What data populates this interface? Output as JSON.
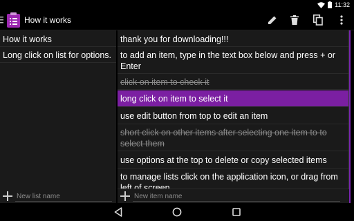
{
  "status_bar": {
    "time": "11:32"
  },
  "action_bar": {
    "title": "How it works",
    "icons": [
      "pencil-icon",
      "trash-icon",
      "copy-icon",
      "overflow-icon"
    ]
  },
  "lists": [
    {
      "label": "How it works"
    },
    {
      "label": "Long click on list for options."
    }
  ],
  "items": [
    {
      "text": "thank you for downloading!!!",
      "state": "normal"
    },
    {
      "text": "to add an item, type in the text box below and press + or Enter",
      "state": "normal"
    },
    {
      "text": "click on item to check it",
      "state": "checked"
    },
    {
      "text": "long click on item to select it",
      "state": "selected"
    },
    {
      "text": "use edit button from top to edit an item",
      "state": "normal"
    },
    {
      "text": "short click on other items after selecting one item to to select them",
      "state": "checked"
    },
    {
      "text": "use options at the top to delete or copy selected items",
      "state": "normal"
    },
    {
      "text": "to manage lists click on the application icon, or drag from left of screen",
      "state": "normal"
    }
  ],
  "new_list": {
    "placeholder": "New list name"
  },
  "new_item": {
    "placeholder": "New item name"
  },
  "colors": {
    "accent": "#7b1fa2",
    "pane": "#1a1a1a",
    "checked_text": "#8a8a8a"
  }
}
